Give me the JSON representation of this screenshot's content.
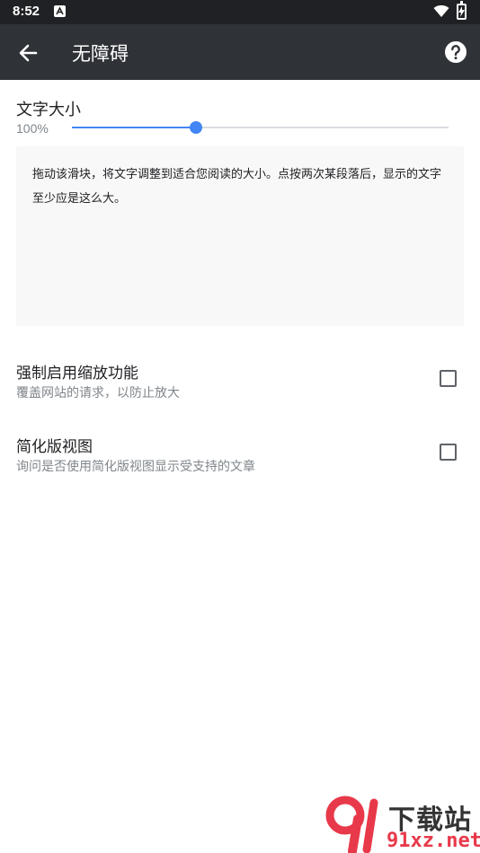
{
  "status_bar": {
    "time": "8:52",
    "icons": [
      "notification-a-icon",
      "wifi-icon",
      "battery-charging-icon"
    ]
  },
  "app_bar": {
    "title": "无障碍",
    "back_icon": "arrow-back-icon",
    "help_icon": "help-circle-icon"
  },
  "text_size": {
    "title": "文字大小",
    "percent": "100%",
    "slider_fraction": 0.33,
    "accent_color": "#4285f4",
    "preview_text": "拖动该滑块，将文字调整到适合您阅读的大小。点按两次某段落后，显示的文字至少应是这么大。"
  },
  "preferences": [
    {
      "title": "强制启用缩放功能",
      "subtitle": "覆盖网站的请求，以防止放大",
      "checked": false
    },
    {
      "title": "简化版视图",
      "subtitle": "询问是否使用简化版视图显示受支持的文章",
      "checked": false
    }
  ],
  "watermark": {
    "top": "下载站",
    "bottom": "91xz.net"
  }
}
